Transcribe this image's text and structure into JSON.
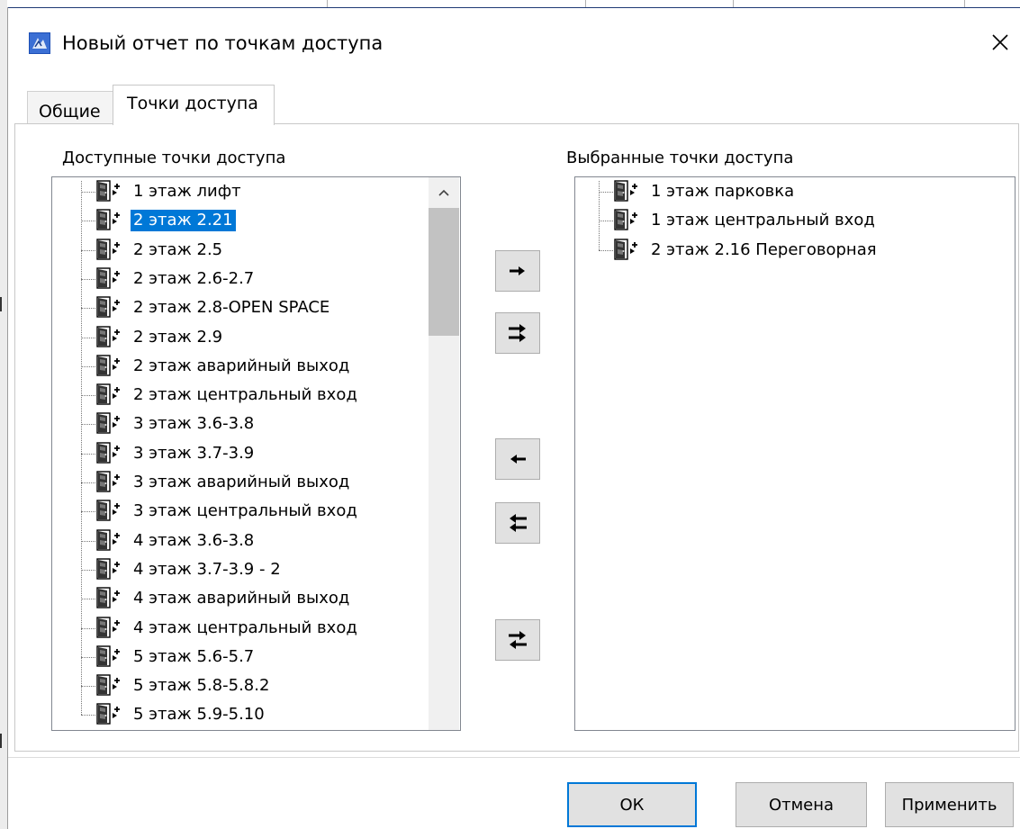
{
  "window": {
    "title": "Новый отчет по точкам доступа",
    "icon": "app-icon",
    "close_icon": "close-icon"
  },
  "tabs": [
    {
      "label": "Общие",
      "active": false
    },
    {
      "label": "Точки доступа",
      "active": true
    }
  ],
  "available": {
    "label": "Доступные точки доступа",
    "items": [
      {
        "label": "1 этаж лифт",
        "selected": false
      },
      {
        "label": "2 этаж 2.21",
        "selected": true
      },
      {
        "label": "2 этаж 2.5",
        "selected": false
      },
      {
        "label": "2 этаж 2.6-2.7",
        "selected": false
      },
      {
        "label": "2 этаж 2.8-OPEN SPACE",
        "selected": false
      },
      {
        "label": "2 этаж 2.9",
        "selected": false
      },
      {
        "label": "2 этаж аварийный выход",
        "selected": false
      },
      {
        "label": "2 этаж центральный вход",
        "selected": false
      },
      {
        "label": "3 этаж 3.6-3.8",
        "selected": false
      },
      {
        "label": "3 этаж 3.7-3.9",
        "selected": false
      },
      {
        "label": "3 этаж аварийный выход",
        "selected": false
      },
      {
        "label": "3 этаж центральный вход",
        "selected": false
      },
      {
        "label": "4 этаж 3.6-3.8",
        "selected": false
      },
      {
        "label": "4 этаж 3.7-3.9 - 2",
        "selected": false
      },
      {
        "label": "4 этаж аварийный выход",
        "selected": false
      },
      {
        "label": "4 этаж центральный вход",
        "selected": false
      },
      {
        "label": "5 этаж 5.6-5.7",
        "selected": false
      },
      {
        "label": "5 этаж 5.8-5.8.2",
        "selected": false
      },
      {
        "label": "5 этаж 5.9-5.10",
        "selected": false
      }
    ]
  },
  "selected": {
    "label": "Выбранные точки доступа",
    "items": [
      {
        "label": "1 этаж парковка"
      },
      {
        "label": "1 этаж центральный вход"
      },
      {
        "label": "2 этаж 2.16 Переговорная"
      }
    ]
  },
  "move_buttons": [
    {
      "name": "add-selected-button",
      "icon": "arrow-right-icon"
    },
    {
      "name": "add-all-button",
      "icon": "double-arrow-right-icon"
    },
    {
      "name": "remove-selected-button",
      "icon": "arrow-left-icon"
    },
    {
      "name": "remove-all-button",
      "icon": "double-arrow-left-icon"
    },
    {
      "name": "swap-button",
      "icon": "swap-arrows-icon"
    }
  ],
  "buttons": {
    "ok": "ОК",
    "cancel": "Отмена",
    "apply": "Применить"
  },
  "colors": {
    "selection": "#0078d7",
    "default_button_border": "#0078d7"
  }
}
